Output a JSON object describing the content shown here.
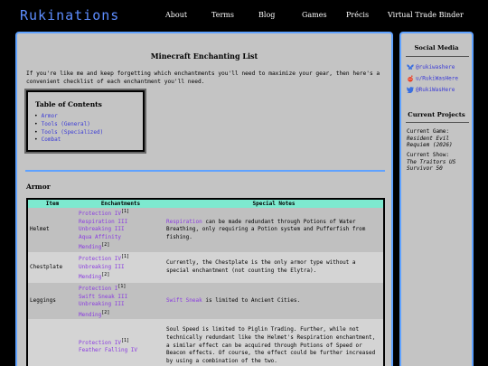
{
  "header": {
    "logo": "Rukinations",
    "nav": [
      "About",
      "Terms",
      "Blog",
      "Games",
      "Précis",
      "Virtual Trade Binder"
    ]
  },
  "main": {
    "title": "Minecraft Enchanting List",
    "intro": "If you're like me and keep forgetting which enchantments you'll need to maximize your gear, then here's a convenient checklist of each enchantment you'll need.",
    "toc": {
      "title": "Table of Contents",
      "items": [
        "Armor",
        "Tools (General)",
        "Tools (Specialized)",
        "Combat"
      ]
    },
    "section_title": "Armor",
    "table": {
      "headers": [
        "Item",
        "Enchantments",
        "Special Notes"
      ],
      "rows": [
        {
          "item": "Helmet",
          "enchantments": [
            {
              "name": "Protection IV",
              "note": "[1]"
            },
            {
              "name": "Respiration III",
              "note": ""
            },
            {
              "name": "Unbreaking III",
              "note": ""
            },
            {
              "name": "Aqua Affinity",
              "note": ""
            },
            {
              "name": "Mending",
              "note": "[2]"
            }
          ],
          "notes_lead": "Respiration",
          "notes_rest": " can be made redundant through Potions of Water Breathing, only requiring a Potion system and Pufferfish from fishing."
        },
        {
          "item": "Chestplate",
          "enchantments": [
            {
              "name": "Protection IV",
              "note": "[1]"
            },
            {
              "name": "Unbreaking III",
              "note": ""
            },
            {
              "name": "Mending",
              "note": "[2]"
            }
          ],
          "notes_lead": "",
          "notes_rest": "Currently, the Chestplate is the only armor type without a special enchantment (not counting the Elytra)."
        },
        {
          "item": "Leggings",
          "enchantments": [
            {
              "name": "Protection I",
              "note": "[1]"
            },
            {
              "name": "Swift Sneak III",
              "note": ""
            },
            {
              "name": "Unbreaking III",
              "note": ""
            },
            {
              "name": "Mending",
              "note": "[2]"
            }
          ],
          "notes_lead": "Swift Sneak",
          "notes_rest": " is limited to Ancient Cities."
        },
        {
          "item": "",
          "enchantments": [
            {
              "name": "Protection IV",
              "note": "[1]"
            },
            {
              "name": "Feather Falling IV",
              "note": ""
            }
          ],
          "notes_lead": "",
          "notes_rest": "Soul Speed is limited to Piglin Trading. Further, while not technically redundant like the Helmet's Respiration enchantment, a similar effect can be acquired through Potions of Speed or Beacon effects. Of course, the effect could be further increased by using a combination of the two."
        }
      ]
    }
  },
  "sidebar": {
    "social_title": "Social Media",
    "social": [
      {
        "icon": "butterfly-icon",
        "label": "@rukiwashere"
      },
      {
        "icon": "reddit-icon",
        "label": "u/RukiWasHere"
      },
      {
        "icon": "twitter-icon",
        "label": "@RukiWasHere"
      }
    ],
    "projects_title": "Current Projects",
    "game_label": "Current Game:",
    "game_value": "Resident Evil Requiem (2026)",
    "show_label": "Current Show:",
    "show_value": "The Traitors US Survivor 50"
  },
  "colors": {
    "accent": "#5fa2ff",
    "logo": "#5d8dff",
    "enchantment": "#8a3be0",
    "table_header": "#7de9cf",
    "link": "#3a3ad6"
  }
}
